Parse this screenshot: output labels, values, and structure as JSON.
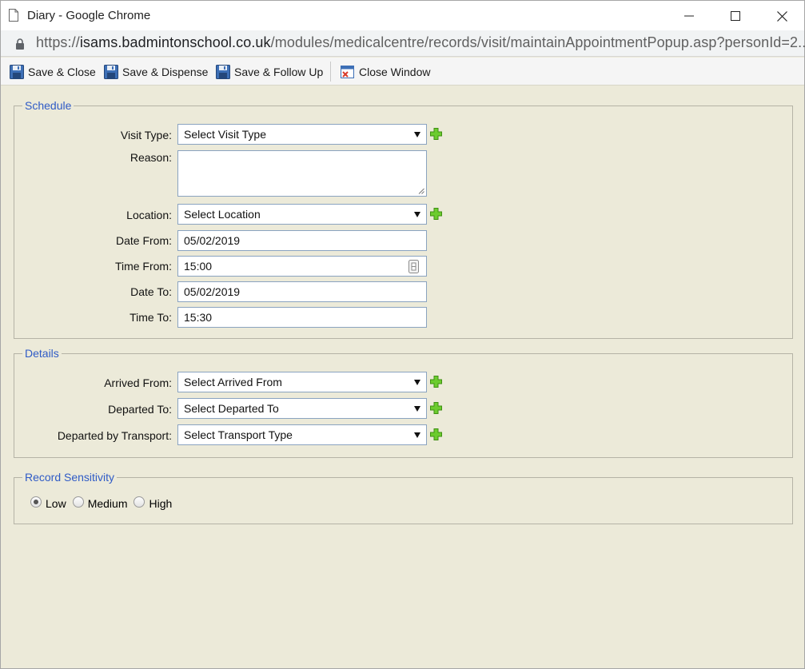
{
  "window": {
    "title": "Diary - Google Chrome",
    "url_scheme": "https://",
    "url_host": "isams.badmintonschool.co.uk",
    "url_path": "/modules/medicalcentre/records/visit/maintainAppointmentPopup.asp?personId=2..."
  },
  "toolbar": {
    "save_close": "Save & Close",
    "save_dispense": "Save & Dispense",
    "save_followup": "Save & Follow Up",
    "close_window": "Close Window"
  },
  "schedule": {
    "legend": "Schedule",
    "visit_type_label": "Visit Type:",
    "visit_type_value": "Select Visit Type",
    "reason_label": "Reason:",
    "reason_value": "",
    "location_label": "Location:",
    "location_value": "Select Location",
    "date_from_label": "Date From:",
    "date_from_value": "05/02/2019",
    "time_from_label": "Time From:",
    "time_from_value": "15:00",
    "date_to_label": "Date To:",
    "date_to_value": "05/02/2019",
    "time_to_label": "Time To:",
    "time_to_value": "15:30"
  },
  "details": {
    "legend": "Details",
    "arrived_from_label": "Arrived From:",
    "arrived_from_value": "Select Arrived From",
    "departed_to_label": "Departed To:",
    "departed_to_value": "Select Departed To",
    "transport_label": "Departed by Transport:",
    "transport_value": "Select Transport Type"
  },
  "sensitivity": {
    "legend": "Record Sensitivity",
    "options": [
      "Low",
      "Medium",
      "High"
    ],
    "selected": "Low"
  },
  "colors": {
    "accent": "#2f5bc6",
    "page_bg": "#ecead9",
    "add_icon": "#5fba2c"
  }
}
